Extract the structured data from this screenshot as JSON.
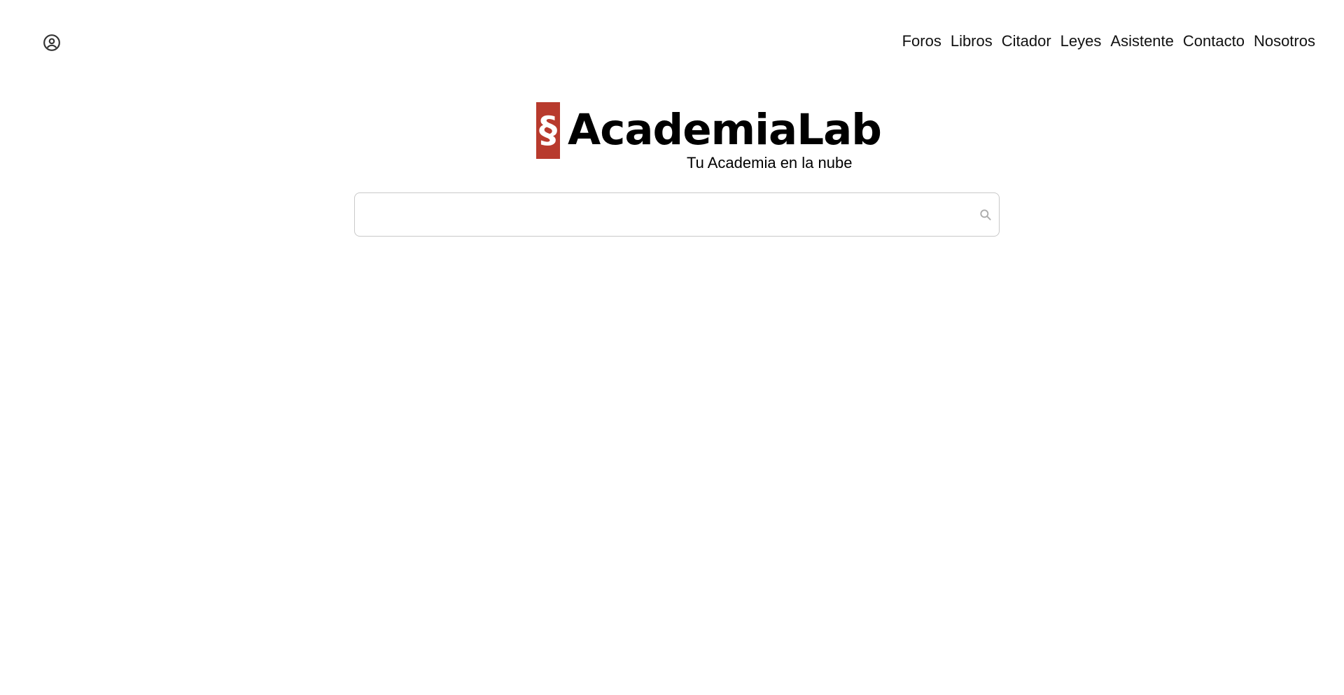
{
  "header": {
    "account_icon": "user-circle-icon",
    "nav": [
      {
        "label": "Foros"
      },
      {
        "label": "Libros"
      },
      {
        "label": "Citador"
      },
      {
        "label": "Leyes"
      },
      {
        "label": "Asistente"
      },
      {
        "label": "Contacto"
      },
      {
        "label": "Nosotros"
      }
    ]
  },
  "brand": {
    "mark": "§",
    "name": "AcademiaLab",
    "tagline": "Tu Academia en la nube",
    "accent_color": "#b83a2d"
  },
  "search": {
    "value": "",
    "placeholder": "",
    "icon": "search-icon"
  }
}
